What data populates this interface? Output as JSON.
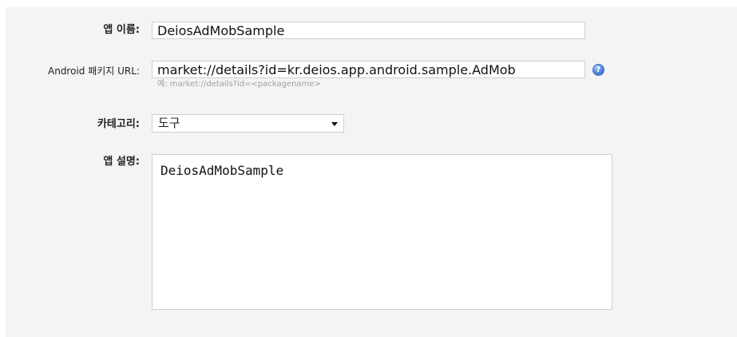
{
  "form": {
    "app_name": {
      "label": "앱 이름:",
      "value": "DeiosAdMobSample"
    },
    "package_url": {
      "label": "Android 패키지 URL:",
      "value": "market://details?id=kr.deios.app.android.sample.AdMob",
      "hint": "예: market://details?id=<packagename>",
      "help_icon": "help-icon"
    },
    "category": {
      "label": "카테고리:",
      "selected": "도구"
    },
    "description": {
      "label": "앱 설명:",
      "value": "DeiosAdMobSample"
    }
  }
}
